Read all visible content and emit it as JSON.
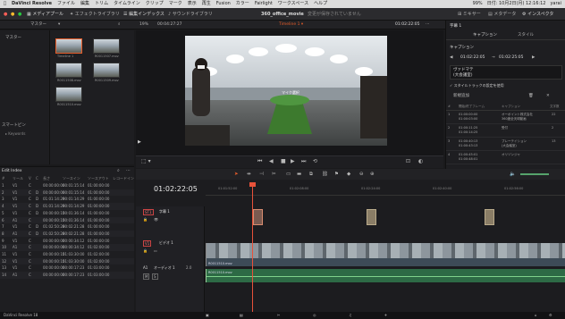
{
  "menubar": {
    "app": "DaVinci Resolve",
    "items": [
      "ファイル",
      "編集",
      "トリム",
      "タイムライン",
      "クリップ",
      "マーク",
      "表示",
      "再生",
      "Fusion",
      "カラー",
      "Fairlight",
      "ワークスペース",
      "ヘルプ"
    ],
    "right": [
      "99%",
      "日付: 10月2日(月) 12:16:12",
      "yarai"
    ]
  },
  "titlebar": {
    "tabs": [
      "メディアプール",
      "エフェクトライブラリ",
      "編集インデックス",
      "サウンドライブラリ"
    ],
    "project": "360_office_movie",
    "saved_status": "変更が保存されていません",
    "right_tabs": [
      "ミキサー",
      "メタデータ",
      "インスペクタ"
    ]
  },
  "pool": {
    "master_label": "マスター",
    "tab_label": "マスター",
    "smart_bins": "スマートビン",
    "keywords": "Keywords",
    "thumbs": [
      {
        "label": "Timeline 1"
      },
      {
        "label": "R0011507.mov"
      },
      {
        "label": "R0011508.mov"
      },
      {
        "label": "R0011509.mov"
      },
      {
        "label": "R0011510.mov"
      }
    ]
  },
  "viewer": {
    "zoom": "19%",
    "timecode": "00:04:27:27",
    "timeline_name": "Timeline 1",
    "current_tc": "01:02:22:05",
    "caption": "マイク選択"
  },
  "edit_index": {
    "title": "Edit Index",
    "headers": [
      "#",
      "リール",
      "V",
      "C",
      "長さ",
      "ソースイン",
      "ソースアウト",
      "レコードイン"
    ],
    "rows": [
      [
        "1",
        "V1",
        "C",
        "",
        "00:00:00:00",
        "00:01:15:14",
        "01:00:00:00"
      ],
      [
        "2",
        "V1",
        "C",
        "D",
        "00:00:00:00",
        "00:01:15:14",
        "01:00:00:00"
      ],
      [
        "3",
        "V1",
        "C",
        "D",
        "01:01:14:29",
        "00:01:14:29",
        "01:00:00:00"
      ],
      [
        "4",
        "V1",
        "C",
        "D",
        "01:01:14:29",
        "00:01:14:29",
        "01:00:00:00"
      ],
      [
        "5",
        "V1",
        "C",
        "D",
        "00:00:00:15",
        "00:01:36:14",
        "01:00:00:00"
      ],
      [
        "6",
        "A1",
        "C",
        "",
        "00:00:00:15",
        "00:01:36:14",
        "01:00:00:00"
      ],
      [
        "7",
        "V1",
        "C",
        "D",
        "01:02:50:28",
        "00:02:21:28",
        "01:00:00:00"
      ],
      [
        "8",
        "A1",
        "C",
        "D",
        "01:02:50:28",
        "00:02:21:28",
        "01:00:00:00"
      ],
      [
        "9",
        "V1",
        "C",
        "",
        "00:00:00:00",
        "00:00:34:12",
        "01:00:00:00"
      ],
      [
        "10",
        "A1",
        "C",
        "",
        "00:00:00:00",
        "00:00:34:12",
        "01:02:00:00"
      ],
      [
        "11",
        "V1",
        "C",
        "",
        "00:00:00:15",
        "01:03:30:00",
        "01:02:00:00"
      ],
      [
        "12",
        "V1",
        "C",
        "",
        "00:00:00:15",
        "01:03:30:00",
        "01:02:00:00"
      ],
      [
        "13",
        "V1",
        "C",
        "",
        "00:00:00:00",
        "00:00:17:23",
        "01:03:00:00"
      ],
      [
        "14",
        "A1",
        "C",
        "",
        "00:00:00:00",
        "00:00:17:23",
        "01:03:00:00"
      ]
    ]
  },
  "inspector": {
    "title": "字幕 1",
    "tab_caption": "キャプション",
    "tab_style": "スタイル",
    "caption_label": "キャプション",
    "tc_in": "01:02:22:05",
    "tc_out": "01:02:25:05",
    "text": "ヴァドマテ\n(大会議室)",
    "use_style": "スタイルトラックの設定を使用",
    "add_caption": "新規追加",
    "list_headers": [
      "#",
      "開始/終了フレーム",
      "キャプション",
      "文字数"
    ],
    "list": [
      {
        "n": "1",
        "tc": "01:00:00:00\n01:00:03:00",
        "cap": "オーポイント株式会社\n360度全天球動画",
        "len": "22"
      },
      {
        "n": "2",
        "tc": "01:00:11:25\n01:00:14:25",
        "cap": "受付",
        "len": "2"
      },
      {
        "n": "3",
        "tc": "01:00:40:13\n01:00:43:13",
        "cap": "プレーテイション\n(大会議室)",
        "len": "13"
      },
      {
        "n": "4",
        "tc": "01:00:45:01\n01:00:48:01",
        "cap": "オリゾンジャ",
        "len": ""
      }
    ]
  },
  "timeline": {
    "timecode": "01:02:22:05",
    "ruler": [
      "01:01:52:00",
      "01:02:08:00",
      "01:02:24:00",
      "01:02:40:00",
      "01:02:56:00",
      "01:03:12:00"
    ],
    "tracks": [
      {
        "id": "ST1",
        "name": "字幕 1"
      },
      {
        "id": "V1",
        "name": "ビデオ 1"
      },
      {
        "id": "A1",
        "name": "オーディオ 1",
        "gain": "2.0"
      }
    ],
    "video_clip_name": "R0011510.mov",
    "audio_clip_name": "R0011510.mov"
  },
  "footer": {
    "app_label": "DaVinci Resolve 18"
  }
}
